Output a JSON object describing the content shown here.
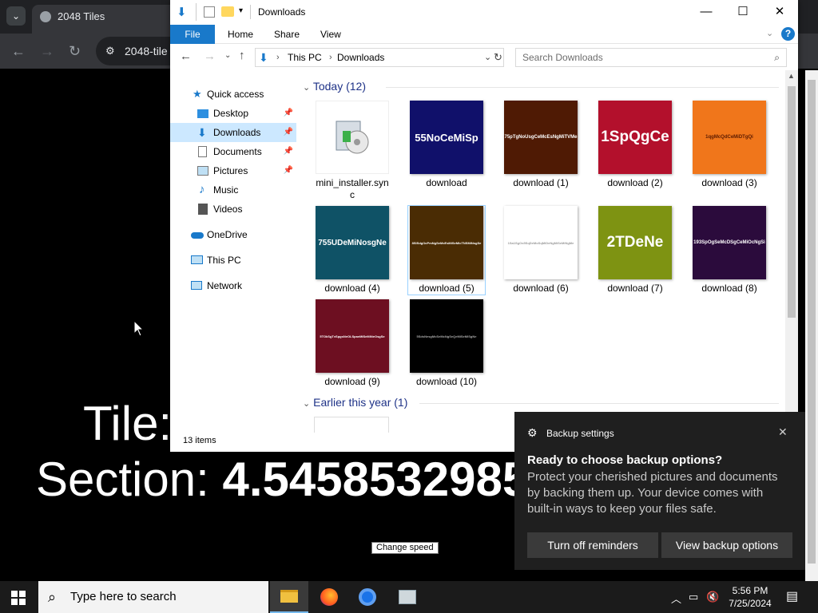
{
  "browser": {
    "tab_title": "2048 Tiles",
    "url": "2048-tile",
    "tab_menu_icon": "chevron-down-icon"
  },
  "page": {
    "line1": "Tile:",
    "line2_label": "Section:",
    "line2_value": "4.5458532985",
    "change_speed": "Change speed"
  },
  "explorer": {
    "title": "Downloads",
    "ribbon": {
      "file": "File",
      "home": "Home",
      "share": "Share",
      "view": "View"
    },
    "address": {
      "this_pc": "This PC",
      "downloads": "Downloads"
    },
    "search_placeholder": "Search Downloads",
    "nav": {
      "quick_access": "Quick access",
      "desktop": "Desktop",
      "downloads": "Downloads",
      "documents": "Documents",
      "pictures": "Pictures",
      "music": "Music",
      "videos": "Videos",
      "onedrive": "OneDrive",
      "this_pc": "This PC",
      "network": "Network"
    },
    "group_today": "Today (12)",
    "group_earlier": "Earlier this year (1)",
    "files": [
      {
        "name": "mini_installer.sync",
        "thumb_text": "",
        "bg": "#ffffff",
        "fg": "#000000"
      },
      {
        "name": "download",
        "thumb_text": "55NoCeMiSp",
        "bg": "#10106a",
        "fg": "#ffffff"
      },
      {
        "name": "download (1)",
        "thumb_text": "75pTgNoUsgCeMcEsNgMiTVMe",
        "bg": "#4f1a04",
        "fg": "#ffffff"
      },
      {
        "name": "download (2)",
        "thumb_text": "1SpQgCe",
        "bg": "#b3102c",
        "fg": "#ffffff"
      },
      {
        "name": "download (3)",
        "thumb_text": "1qgMcQdCeMiDTgQi",
        "bg": "#f0761b",
        "fg": "#5a1a00"
      },
      {
        "name": "download (4)",
        "thumb_text": "755UDeMiNosgNe",
        "bg": "#0f5266",
        "fg": "#ffffff"
      },
      {
        "name": "download (5)",
        "thumb_text": "8SlSdgOcPmNgSeMcEsMiSeMlcTNSMiNsgSe",
        "bg": "#4a2c04",
        "fg": "#ffffff"
      },
      {
        "name": "download (6)",
        "thumb_text": "1Sa1SgOs5SqDeMoSqMiDeNgMiSeMiNgMe",
        "bg": "#ffffff",
        "fg": "#999999"
      },
      {
        "name": "download (7)",
        "thumb_text": "2TDeNe",
        "bg": "#7e9312",
        "fg": "#ffffff"
      },
      {
        "name": "download (8)",
        "thumb_text": "193SpOgSeMcDSgCeMiOcNgSi",
        "bg": "#2b0b3c",
        "fg": "#ffffff"
      },
      {
        "name": "download (9)",
        "thumb_text": "5TOkSgTvSpgsNeOLSpaeMiSeMiNeOsgSe",
        "bg": "#6d0f21",
        "fg": "#ffffff"
      },
      {
        "name": "download (10)",
        "thumb_text": "5SdsNesgMcSeMcNgSeQeMiSeMiSgNe",
        "bg": "#000000",
        "fg": "#aaaaaa"
      }
    ],
    "status": "13 items"
  },
  "toast": {
    "header": "Backup settings",
    "title": "Ready to choose backup options?",
    "body": "Protect your cherished pictures and documents by backing them up. Your device comes with built-in ways to keep your files safe.",
    "btn_off": "Turn off reminders",
    "btn_view": "View backup options"
  },
  "taskbar": {
    "search_placeholder": "Type here to search",
    "time": "5:56 PM",
    "date": "7/25/2024"
  },
  "colors": {
    "accent": "#1979ca",
    "selection": "#cce8ff",
    "taskbar": "#1b1b1b"
  }
}
